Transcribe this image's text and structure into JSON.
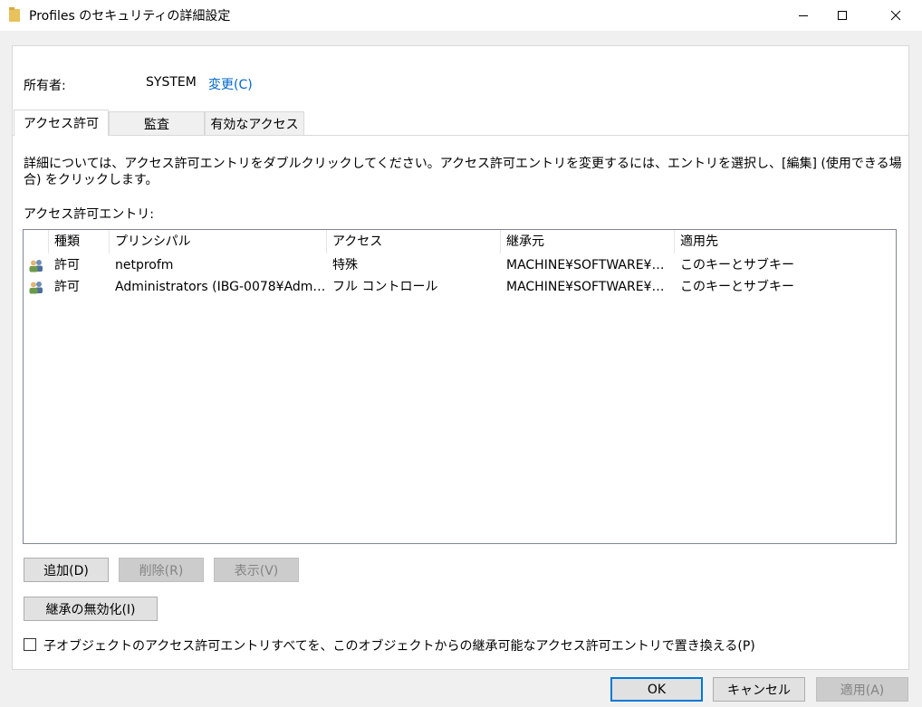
{
  "window": {
    "title": "Profiles のセキュリティの詳細設定",
    "folder_icon_color": "#e8c25a"
  },
  "owner": {
    "label": "所有者:",
    "value": "SYSTEM",
    "change_link": "変更(C)"
  },
  "tabs": [
    {
      "label": "アクセス許可",
      "active": true
    },
    {
      "label": "監査",
      "active": false
    },
    {
      "label": "有効なアクセス",
      "active": false
    }
  ],
  "description": "詳細については、アクセス許可エントリをダブルクリックしてください。アクセス許可エントリを変更するには、エントリを選択し、[編集] (使用できる場合) をクリックします。",
  "entries_label": "アクセス許可エントリ:",
  "table": {
    "columns": [
      "種類",
      "プリンシパル",
      "アクセス",
      "継承元",
      "適用先"
    ],
    "rows": [
      {
        "type": "許可",
        "principal": "netprofm",
        "access": "特殊",
        "inherited_from": "MACHINE¥SOFTWARE¥M...",
        "applies_to": "このキーとサブキー"
      },
      {
        "type": "許可",
        "principal": "Administrators (IBG-0078¥Admin...",
        "access": "フル コントロール",
        "inherited_from": "MACHINE¥SOFTWARE¥M...",
        "applies_to": "このキーとサブキー"
      }
    ]
  },
  "buttons": {
    "add": "追加(D)",
    "remove": "削除(R)",
    "view": "表示(V)",
    "disable_inheritance": "継承の無効化(I)",
    "ok": "OK",
    "cancel": "キャンセル",
    "apply": "適用(A)"
  },
  "replace_checkbox": {
    "label": "子オブジェクトのアクセス許可エントリすべてを、このオブジェクトからの継承可能なアクセス許可エントリで置き換える(P)",
    "checked": false
  }
}
